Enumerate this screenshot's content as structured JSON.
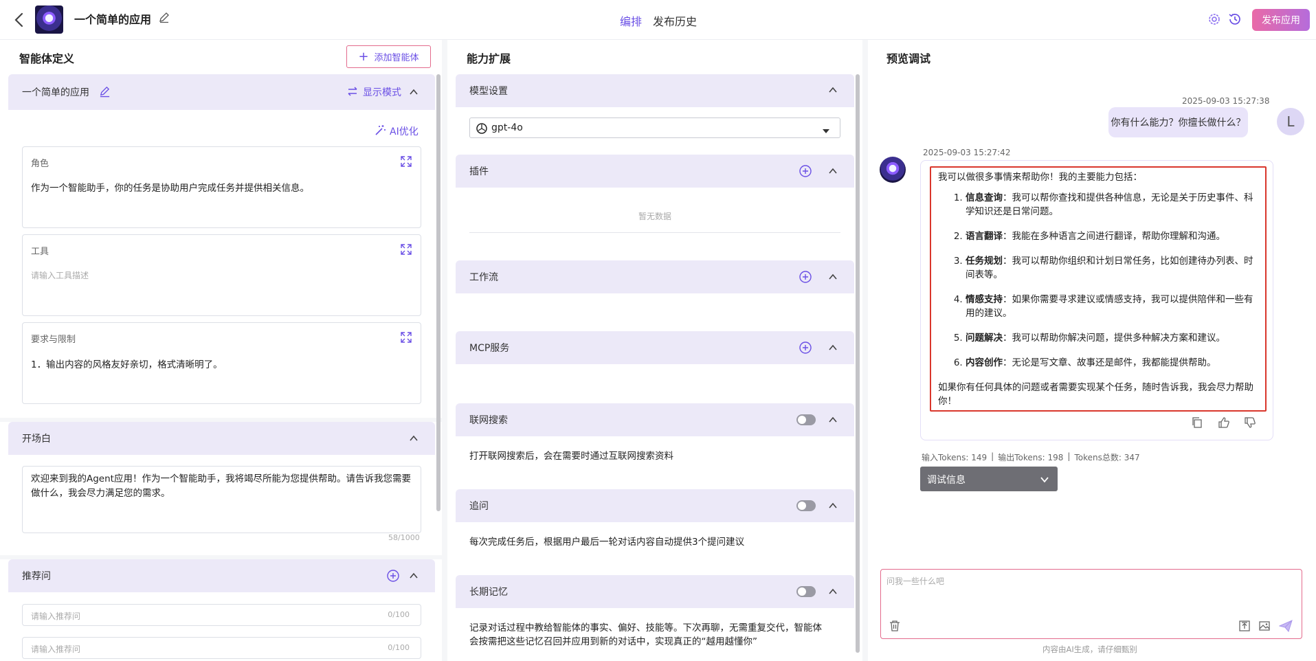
{
  "header": {
    "app_name": "一个简单的应用",
    "tabs": [
      {
        "label": "编排"
      },
      {
        "label": "发布历史"
      }
    ],
    "publish_label": "发布应用"
  },
  "left": {
    "title": "智能体定义",
    "add_agent_label": "添加智能体",
    "agent_name": "一个简单的应用",
    "display_mode_label": "显示模式",
    "ai_optimize_label": "AI优化",
    "role": {
      "label": "角色",
      "value": "作为一个智能助手，你的任务是协助用户完成任务并提供相关信息。"
    },
    "tools": {
      "label": "工具",
      "placeholder": "请输入工具描述"
    },
    "requirements": {
      "label": "要求与限制",
      "value": "1．输出内容的风格友好亲切，格式清晰明了。"
    },
    "opening": {
      "label": "开场白",
      "value": "欢迎来到我的Agent应用！作为一个智能助手，我将竭尽所能为您提供帮助。请告诉我您需要做什么，我会尽力满足您的需求。",
      "count": "58/1000"
    },
    "suggested": {
      "label": "推荐问",
      "items": [
        {
          "placeholder": "请输入推荐问",
          "count": "0/100"
        },
        {
          "placeholder": "请输入推荐问",
          "count": "0/100"
        }
      ]
    }
  },
  "middle": {
    "title": "能力扩展",
    "model": {
      "label": "模型设置",
      "selected": "gpt-4o"
    },
    "plugins": {
      "label": "插件",
      "empty": "暂无数据"
    },
    "workflow": {
      "label": "工作流"
    },
    "mcp": {
      "label": "MCP服务"
    },
    "web_search": {
      "label": "联网搜索",
      "desc": "打开联网搜索后，会在需要时通过互联网搜索资料",
      "enabled": false
    },
    "followup": {
      "label": "追问",
      "desc": "每次完成任务后，根据用户最后一轮对话内容自动提供3个提问建议",
      "enabled": false
    },
    "memory": {
      "label": "长期记忆",
      "desc_line1": "记录对话过程中教给智能体的事实、偏好、技能等。下次再聊，无需重复交代，智能体",
      "desc_line2": "会按需把这些记忆召回并应用到新的对话中，实现真正的“越用越懂你”",
      "enabled": false
    }
  },
  "right": {
    "title": "预览调试",
    "user_msg": {
      "time": "2025-09-03 15:27:38",
      "text": "你有什么能力？你擅长做什么？",
      "avatar": "L"
    },
    "bot_msg": {
      "time": "2025-09-03 15:27:42",
      "intro": "我可以做很多事情来帮助你！我的主要能力包括：",
      "items": [
        {
          "title": "信息查询",
          "text": "：我可以帮你查找和提供各种信息，无论是关于历史事件、科学知识还是日常问题。"
        },
        {
          "title": "语言翻译",
          "text": "：我能在多种语言之间进行翻译，帮助你理解和沟通。"
        },
        {
          "title": "任务规划",
          "text": "：我可以帮助你组织和计划日常任务，比如创建待办列表、时间表等。"
        },
        {
          "title": "情感支持",
          "text": "：如果你需要寻求建议或情感支持，我可以提供陪伴和一些有用的建议。"
        },
        {
          "title": "问题解决",
          "text": "：我可以帮助你解决问题，提供多种解决方案和建议。"
        },
        {
          "title": "内容创作",
          "text": "：无论是写文章、故事还是邮件，我都能提供帮助。"
        }
      ],
      "outro": "如果你有任何具体的问题或者需要实现某个任务，随时告诉我，我会尽力帮助你！"
    },
    "tokens": {
      "input": "输入Tokens: 149",
      "output": "输出Tokens: 198",
      "total": "Tokens总数: 347"
    },
    "debug_label": "调试信息",
    "input_placeholder": "问我一些什么吧",
    "footer_note": "内容由AI生成，请仔细甄别"
  },
  "colors": {
    "accent": "#6a4fe5",
    "section_head": "#ece9f8",
    "highlight_border": "#d9362b"
  }
}
